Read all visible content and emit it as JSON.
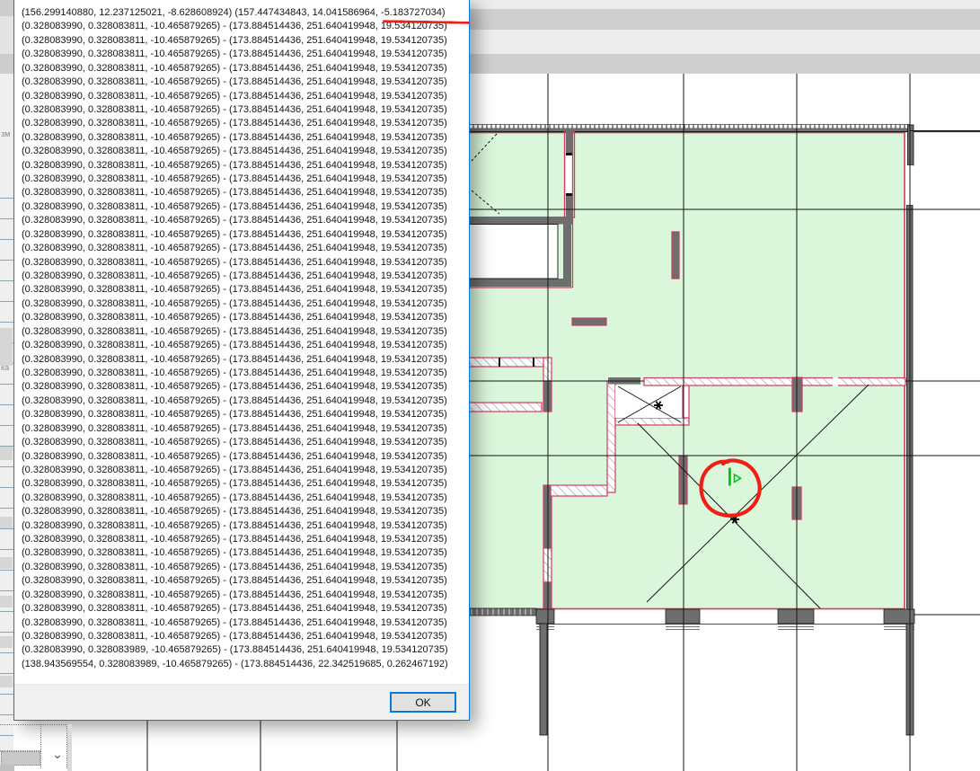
{
  "dialog": {
    "header_line": "(156.299140880, 12.237125021, -8.628608924) (157.447434843, 14.041586964, -5.183727034)",
    "repeated_line": "(0.328083990, 0.328083811, -10.465879265) - (173.884514436, 251.640419948, 19.534120735)",
    "repeated_count": 45,
    "penultimate_line": "(0.328083990, 0.328083989, -10.465879265) - (173.884514436, 251.640419948, 19.534120735)",
    "last_line": "(138.943569554, 0.328083989, -10.465879265) - (173.884514436, 22.342519685, 0.262467192)",
    "ok_label": "OK"
  },
  "left_panel": {
    "fragment_top": "зм",
    "fragment_bottom": "ка"
  },
  "widget": {
    "chevron_glyph": "⌄"
  },
  "colors": {
    "accent_blue": "#0a78d7",
    "annotation_red": "#e8231a",
    "marker_green": "#00c414",
    "plan_green": "#dbf7db",
    "wall_crimson": "#d23a64",
    "wall_gray": "#707070"
  }
}
